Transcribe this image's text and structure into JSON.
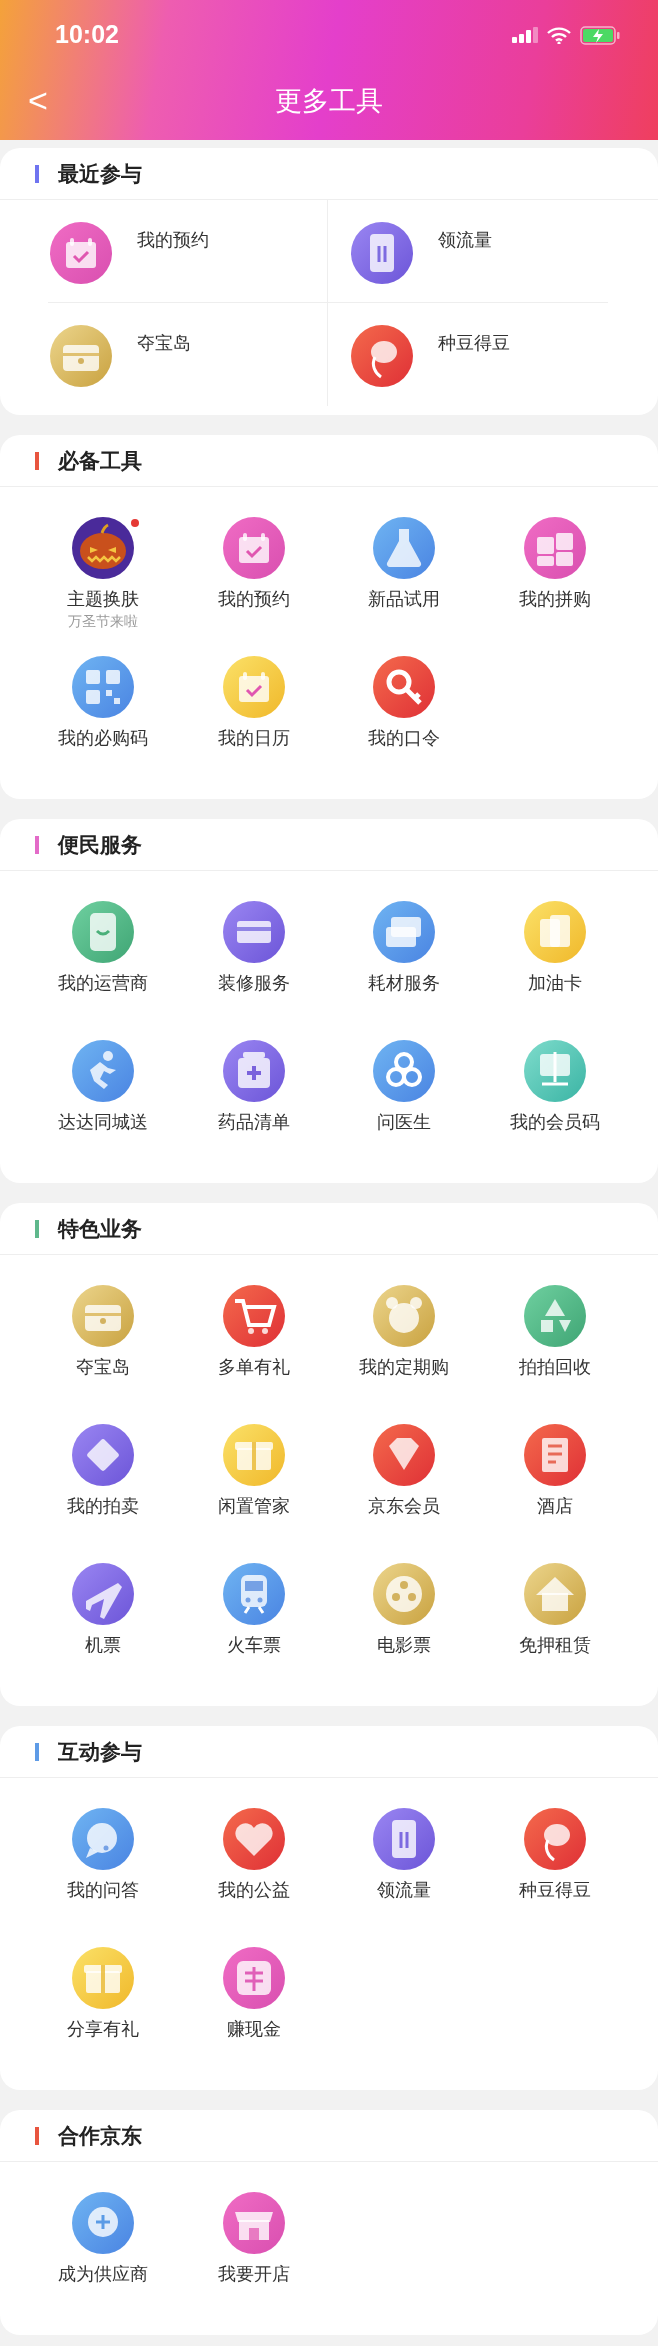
{
  "status_bar": {
    "time": "10:02"
  },
  "nav": {
    "back": "<",
    "title": "更多工具"
  },
  "recent": {
    "title": "最近参与",
    "color": "#6f74f0",
    "items": [
      {
        "label": "我的预约"
      },
      {
        "label": "领流量"
      },
      {
        "label": "夺宝岛"
      },
      {
        "label": "种豆得豆"
      }
    ]
  },
  "sections": [
    {
      "title": "必备工具",
      "color": "#e8553f",
      "items": [
        {
          "label": "主题换肤",
          "subtitle": "万圣节来啦",
          "dot": true
        },
        {
          "label": "我的预约",
          "dot": false
        },
        {
          "label": "新品试用",
          "dot": false
        },
        {
          "label": "我的拼购",
          "dot": false
        },
        {
          "label": "我的必购码",
          "dot": false
        },
        {
          "label": "我的日历",
          "dot": false
        },
        {
          "label": "我的口令",
          "dot": false
        }
      ]
    },
    {
      "title": "便民服务",
      "color": "#e36bc8",
      "items": [
        {
          "label": "我的运营商"
        },
        {
          "label": "装修服务"
        },
        {
          "label": "耗材服务"
        },
        {
          "label": "加油卡"
        },
        {
          "label": "达达同城送"
        },
        {
          "label": "药品清单"
        },
        {
          "label": "问医生"
        },
        {
          "label": "我的会员码"
        }
      ]
    },
    {
      "title": "特色业务",
      "color": "#5fb88c",
      "items": [
        {
          "label": "夺宝岛"
        },
        {
          "label": "多单有礼"
        },
        {
          "label": "我的定期购"
        },
        {
          "label": "拍拍回收"
        },
        {
          "label": "我的拍卖"
        },
        {
          "label": "闲置管家"
        },
        {
          "label": "京东会员"
        },
        {
          "label": "酒店"
        },
        {
          "label": "机票"
        },
        {
          "label": "火车票"
        },
        {
          "label": "电影票"
        },
        {
          "label": "免押租赁"
        }
      ]
    },
    {
      "title": "互动参与",
      "color": "#5e9be6",
      "items": [
        {
          "label": "我的问答"
        },
        {
          "label": "我的公益"
        },
        {
          "label": "领流量"
        },
        {
          "label": "种豆得豆"
        },
        {
          "label": "分享有礼"
        },
        {
          "label": "赚现金"
        }
      ]
    },
    {
      "title": "合作京东",
      "color": "#e8553f",
      "items": [
        {
          "label": "成为供应商"
        },
        {
          "label": "我要开店"
        }
      ]
    }
  ]
}
